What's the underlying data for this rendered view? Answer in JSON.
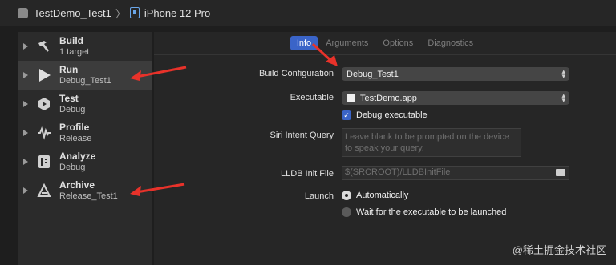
{
  "titlebar": {
    "scheme": "TestDemo_Test1",
    "separator": "〉",
    "device": "iPhone 12 Pro"
  },
  "sidebar": {
    "items": [
      {
        "title": "Build",
        "subtitle": "1 target",
        "icon": "hammer-icon"
      },
      {
        "title": "Run",
        "subtitle": "Debug_Test1",
        "icon": "play-icon",
        "selected": true
      },
      {
        "title": "Test",
        "subtitle": "Debug",
        "icon": "test-icon"
      },
      {
        "title": "Profile",
        "subtitle": "Release",
        "icon": "waveform-icon"
      },
      {
        "title": "Analyze",
        "subtitle": "Debug",
        "icon": "analyze-icon"
      },
      {
        "title": "Archive",
        "subtitle": "Release_Test1",
        "icon": "archive-icon"
      }
    ]
  },
  "tabs": [
    "Info",
    "Arguments",
    "Options",
    "Diagnostics"
  ],
  "form": {
    "build_configuration_label": "Build Configuration",
    "build_configuration_value": "Debug_Test1",
    "executable_label": "Executable",
    "executable_value": "TestDemo.app",
    "debug_executable_label": "Debug executable",
    "siri_label": "Siri Intent Query",
    "siri_placeholder": "Leave blank to be prompted on the device to speak your query.",
    "lldb_label": "LLDB Init File",
    "lldb_placeholder": "$(SRCROOT)/LLDBInitFile",
    "launch_label": "Launch",
    "launch_option_auto": "Automatically",
    "launch_option_wait": "Wait for the executable to be launched"
  },
  "watermark": "@稀土掘金技术社区",
  "colors": {
    "accent": "#3a64c8",
    "annotation_arrow": "#e8322a"
  }
}
